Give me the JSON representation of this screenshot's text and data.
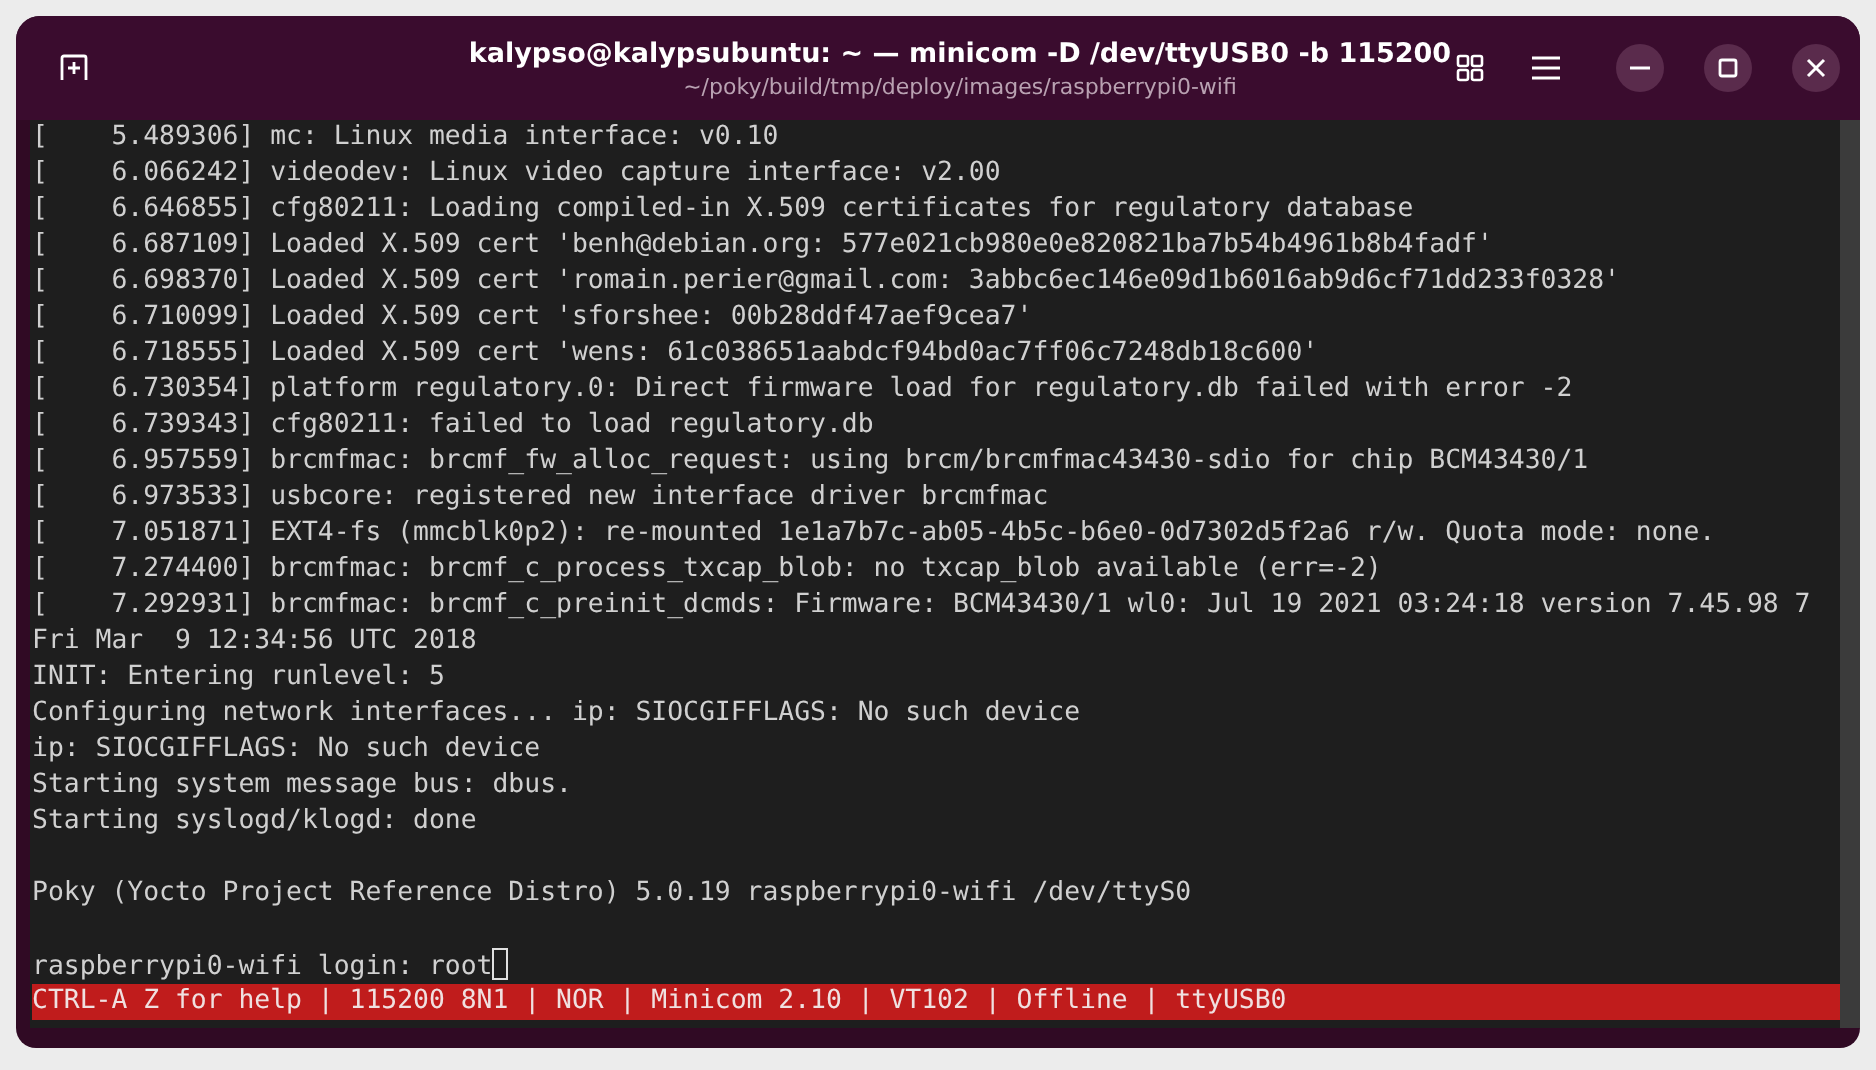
{
  "window": {
    "title": "kalypso@kalypsubuntu: ~ — minicom -D /dev/ttyUSB0 -b 115200",
    "subtitle": "~/poky/build/tmp/deploy/images/raspberrypi0-wifi"
  },
  "terminal": {
    "lines": [
      {
        "kind": "text",
        "text": "[    5.489306] mc: Linux media interface: v0.10"
      },
      {
        "kind": "text",
        "text": "[    6.066242] videodev: Linux video capture interface: v2.00"
      },
      {
        "kind": "text",
        "text": "[    6.646855] cfg80211: Loading compiled-in X.509 certificates for regulatory database"
      },
      {
        "kind": "text",
        "text": "[    6.687109] Loaded X.509 cert 'benh@debian.org: 577e021cb980e0e820821ba7b54b4961b8b4fadf'"
      },
      {
        "kind": "text",
        "text": "[    6.698370] Loaded X.509 cert 'romain.perier@gmail.com: 3abbc6ec146e09d1b6016ab9d6cf71dd233f0328'"
      },
      {
        "kind": "text",
        "text": "[    6.710099] Loaded X.509 cert 'sforshee: 00b28ddf47aef9cea7'"
      },
      {
        "kind": "text",
        "text": "[    6.718555] Loaded X.509 cert 'wens: 61c038651aabdcf94bd0ac7ff06c7248db18c600'"
      },
      {
        "kind": "text",
        "text": "[    6.730354] platform regulatory.0: Direct firmware load for regulatory.db failed with error -2"
      },
      {
        "kind": "text",
        "text": "[    6.739343] cfg80211: failed to load regulatory.db"
      },
      {
        "kind": "text",
        "text": "[    6.957559] brcmfmac: brcmf_fw_alloc_request: using brcm/brcmfmac43430-sdio for chip BCM43430/1"
      },
      {
        "kind": "text",
        "text": "[    6.973533] usbcore: registered new interface driver brcmfmac"
      },
      {
        "kind": "text",
        "text": "[    7.051871] EXT4-fs (mmcblk0p2): re-mounted 1e1a7b7c-ab05-4b5c-b6e0-0d7302d5f2a6 r/w. Quota mode: none."
      },
      {
        "kind": "text",
        "text": "[    7.274400] brcmfmac: brcmf_c_process_txcap_blob: no txcap_blob available (err=-2)"
      },
      {
        "kind": "text",
        "text": "[    7.292931] brcmfmac: brcmf_c_preinit_dcmds: Firmware: BCM43430/1 wl0: Jul 19 2021 03:24:18 version 7.45.98 7"
      },
      {
        "kind": "text",
        "text": "Fri Mar  9 12:34:56 UTC 2018"
      },
      {
        "kind": "text",
        "text": "INIT: Entering runlevel: 5"
      },
      {
        "kind": "text",
        "text": "Configuring network interfaces... ip: SIOCGIFFLAGS: No such device"
      },
      {
        "kind": "text",
        "text": "ip: SIOCGIFFLAGS: No such device"
      },
      {
        "kind": "text",
        "text": "Starting system message bus: dbus."
      },
      {
        "kind": "text",
        "text": "Starting syslogd/klogd: done"
      },
      {
        "kind": "blank"
      },
      {
        "kind": "text",
        "text": "Poky (Yocto Project Reference Distro) 5.0.19 raspberrypi0-wifi /dev/ttyS0"
      },
      {
        "kind": "blank"
      },
      {
        "kind": "prompt",
        "text": "raspberrypi0-wifi login: root"
      }
    ],
    "status_bar": "CTRL-A Z for help | 115200 8N1 | NOR | Minicom 2.10 | VT102 | Offline | ttyUSB0"
  }
}
